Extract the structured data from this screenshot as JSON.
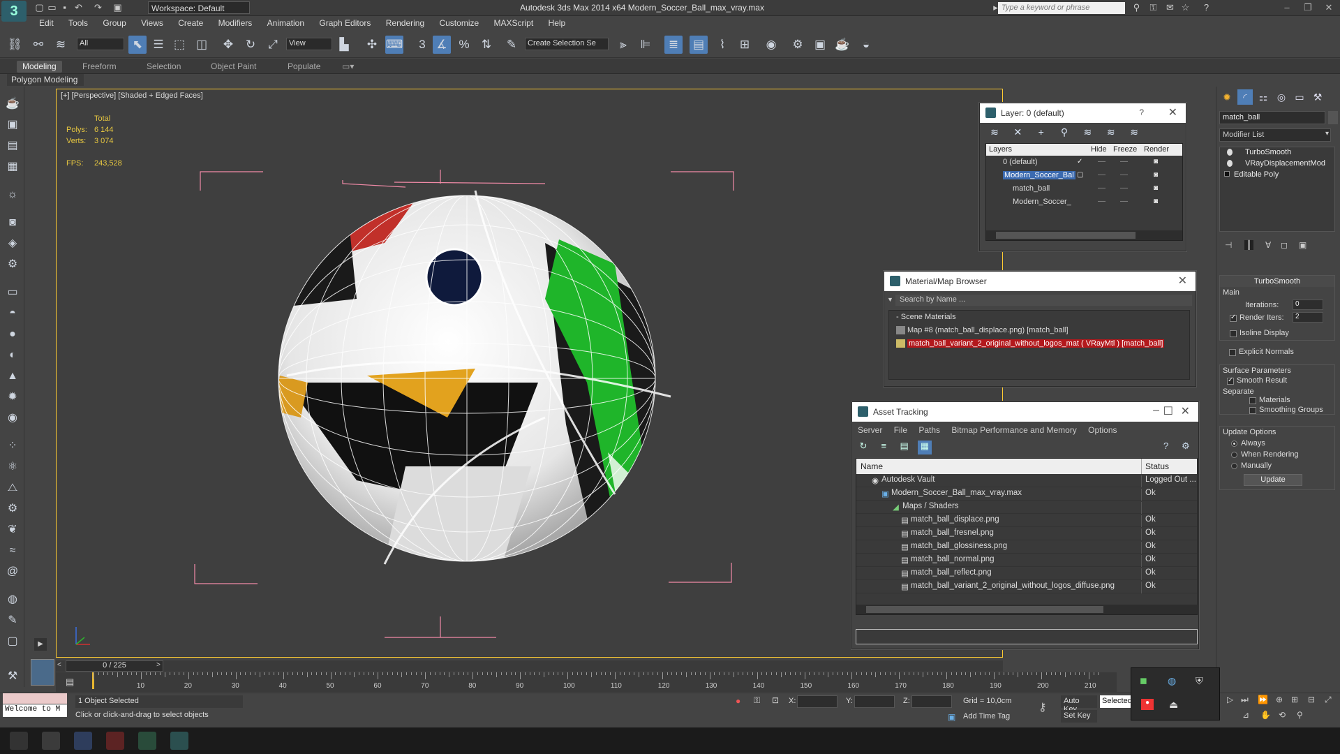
{
  "titlebar": {
    "workspace_label": "Workspace: Default",
    "title": "Autodesk 3ds Max  2014 x64     Modern_Soccer_Ball_max_vray.max",
    "search_placeholder": "Type a keyword or phrase"
  },
  "menu": [
    "Edit",
    "Tools",
    "Group",
    "Views",
    "Create",
    "Modifiers",
    "Animation",
    "Graph Editors",
    "Rendering",
    "Customize",
    "MAXScript",
    "Help"
  ],
  "toolbar": {
    "selection_filter": "All",
    "ref_coord": "View",
    "named_selection": "Create Selection Se",
    "snap_3": "3",
    "icons": [
      "link-icon",
      "unlink-icon",
      "bind-spacewarp-icon",
      "select-icon",
      "select-by-name-icon",
      "rect-region-icon",
      "window-crossing-icon",
      "move-icon",
      "rotate-icon",
      "scale-icon",
      "mirror-icon",
      "align-icon",
      "layer-manager-icon",
      "render-setup-icon",
      "render-icon",
      "teapot-icon"
    ]
  },
  "ribbon": {
    "tabs": [
      "Modeling",
      "Freeform",
      "Selection",
      "Object Paint",
      "Populate"
    ],
    "active_tab": "Modeling",
    "panel_label": "Polygon Modeling"
  },
  "viewport": {
    "label": "[+] [Perspective] [Shaded + Edged Faces]",
    "stats_header": "Total",
    "polys_label": "Polys:",
    "polys_value": "6 144",
    "verts_label": "Verts:",
    "verts_value": "3 074",
    "fps_label": "FPS:",
    "fps_value": "243,528"
  },
  "layer_panel": {
    "title": "Layer: 0 (default)",
    "help": "?",
    "columns": [
      "Layers",
      "Hide",
      "Freeze",
      "Render"
    ],
    "rows": [
      {
        "name": "0 (default)",
        "indent": 0
      },
      {
        "name": "Modern_Soccer_Bal",
        "indent": 0,
        "selected": true
      },
      {
        "name": "match_ball",
        "indent": 1
      },
      {
        "name": "Modern_Soccer_",
        "indent": 1
      }
    ]
  },
  "material_panel": {
    "title": "Material/Map Browser",
    "search_placeholder": "Search by Name ...",
    "group": "Scene Materials",
    "items": [
      "Map #8 (match_ball_displace.png) [match_ball]",
      "match_ball_variant_2_original_without_logos_mat ( VRayMtl ) [match_ball]"
    ]
  },
  "asset_panel": {
    "title": "Asset Tracking",
    "menu": [
      "Server",
      "File",
      "Paths",
      "Bitmap Performance and Memory",
      "Options"
    ],
    "col_name": "Name",
    "col_status": "Status",
    "rows": [
      {
        "name": "Autodesk Vault",
        "status": "Logged Out ...",
        "indent": 1
      },
      {
        "name": "Modern_Soccer_Ball_max_vray.max",
        "status": "Ok",
        "indent": 2
      },
      {
        "name": "Maps / Shaders",
        "status": "",
        "indent": 3
      },
      {
        "name": "match_ball_displace.png",
        "status": "Ok",
        "indent": 4
      },
      {
        "name": "match_ball_fresnel.png",
        "status": "Ok",
        "indent": 4
      },
      {
        "name": "match_ball_glossiness.png",
        "status": "Ok",
        "indent": 4
      },
      {
        "name": "match_ball_normal.png",
        "status": "Ok",
        "indent": 4
      },
      {
        "name": "match_ball_reflect.png",
        "status": "Ok",
        "indent": 4
      },
      {
        "name": "match_ball_variant_2_original_without_logos_diffuse.png",
        "status": "Ok",
        "indent": 4
      }
    ]
  },
  "command_panel": {
    "object_name": "match_ball",
    "modifier_list": "Modifier List",
    "stack": [
      "TurboSmooth",
      "VRayDisplacementMod",
      "Editable Poly"
    ],
    "turbosmooth": {
      "title": "TurboSmooth",
      "main": "Main",
      "iterations_label": "Iterations:",
      "iterations_value": "0",
      "render_iters_label": "Render Iters:",
      "render_iters_value": "2",
      "isoline": "Isoline Display",
      "explicit_normals": "Explicit Normals",
      "surface_params": "Surface Parameters",
      "smooth_result": "Smooth Result",
      "separate": "Separate",
      "materials": "Materials",
      "smoothing_groups": "Smoothing Groups",
      "update_options": "Update Options",
      "always": "Always",
      "when_rendering": "When Rendering",
      "manually": "Manually",
      "update_button": "Update"
    }
  },
  "timeline": {
    "frame_display": "0 / 225",
    "ticks": [
      "10",
      "20",
      "30",
      "40",
      "50",
      "60",
      "70",
      "80",
      "90",
      "100",
      "110",
      "120",
      "130",
      "140",
      "150",
      "160",
      "170",
      "180",
      "190",
      "200",
      "210"
    ]
  },
  "status": {
    "maxscript": "Welcome to M",
    "selection": "1 Object Selected",
    "prompt": "Click or click-and-drag to select objects",
    "x": "X:",
    "y": "Y:",
    "z": "Z:",
    "grid": "Grid = 10,0cm",
    "add_time_tag": "Add Time Tag",
    "auto_key": "Auto Key",
    "set_key": "Set Key",
    "key_mode": "Selected"
  }
}
